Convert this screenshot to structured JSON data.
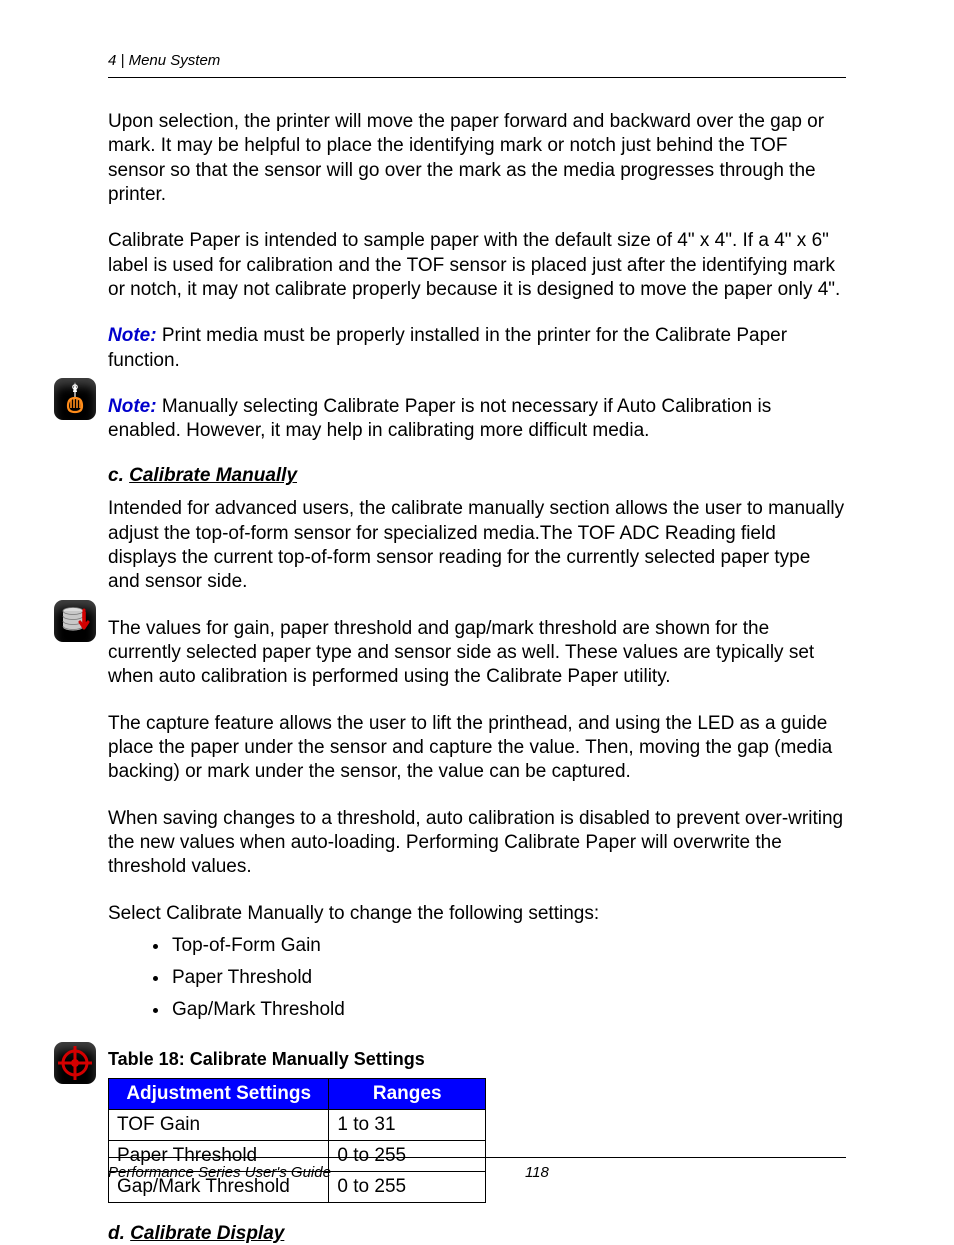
{
  "header": {
    "chapter_num": "4",
    "chapter_title": "Menu System",
    "separator": "  |  "
  },
  "paragraphs": {
    "p1": "Upon selection, the printer will move the paper forward and backward over the gap or mark. It may be helpful to place the identifying mark or notch just behind the TOF sensor so that the sensor will go over the mark as the media progresses through the printer.",
    "p2": "Calibrate Paper is intended to sample paper with the default size of 4\" x 4\". If a 4\" x 6\" label is used for calibration and the TOF sensor is placed just after the identifying mark or notch, it may not calibrate properly because it is designed to move the paper only 4\".",
    "note1_label": "Note:",
    "note1_text": " Print media must be properly installed in the printer for the Calibrate Paper function.",
    "note2_label": "Note:",
    "note2_text": " Manually selecting Calibrate Paper is not necessary if Auto Calibration is enabled. However, it may help in calibrating more difficult media.",
    "section_c_letter": "c. ",
    "section_c_title": "Calibrate Manually",
    "p3": "Intended for advanced users, the calibrate manually section allows the user to manually adjust the top-of-form sensor for specialized media.The TOF ADC Reading field displays the current top-of-form sensor reading for the currently selected paper type and sensor side.",
    "p4": "The values for gain, paper threshold and gap/mark threshold are shown for the currently selected paper type and sensor side as well. These values are typically set when auto calibration is performed using the Calibrate Paper utility.",
    "p5": "The capture feature allows the user to lift the printhead, and using the LED as a guide place the paper under the sensor and capture the value. Then, moving the gap (media backing) or mark under the sensor, the value can be captured.",
    "p6": "When saving changes to a threshold, auto calibration is disabled to prevent over-writing the new values when auto-loading. Performing Calibrate Paper will overwrite the threshold values.",
    "p7": "Select Calibrate Manually to change the following settings:",
    "section_d_letter": "d. ",
    "section_d_title": "Calibrate Display"
  },
  "bullets": [
    "Top-of-Form Gain",
    "Paper Threshold",
    "Gap/Mark Threshold"
  ],
  "table": {
    "caption": "Table 18: Calibrate Manually Settings",
    "headers": [
      "Adjustment Settings",
      "Ranges"
    ],
    "col_widths": [
      "221px",
      "157px"
    ],
    "rows": [
      [
        "TOF Gain",
        "1 to 31"
      ],
      [
        "Paper Threshold",
        "0 to 255"
      ],
      [
        "Gap/Mark Threshold",
        "0 to 255"
      ]
    ]
  },
  "footer": {
    "title": "Performance Series User's Guide",
    "page": "118"
  }
}
